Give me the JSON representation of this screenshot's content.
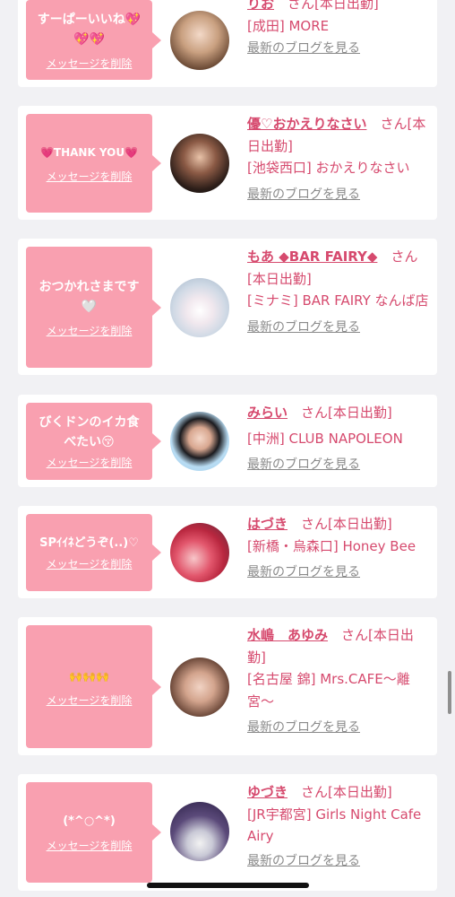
{
  "colors": {
    "bubble": "#f9a0b0",
    "accent": "#d64a6e",
    "link_gray": "#8a8a8a",
    "background": "#f1f1f4"
  },
  "common": {
    "delete_label": "メッセージを削除",
    "blog_label": "最新のブログを見る",
    "san": "さん"
  },
  "cards": [
    {
      "message": "すーぱーいいね💖💖💖",
      "name": "りお",
      "suffix": "さん[本日出勤]",
      "shop": "[成田] MORE",
      "avatar_icon": "avatar-photo"
    },
    {
      "message": "💗THANK YOU💗",
      "name": "優♡おかえりなさい",
      "suffix": "さん[本日出勤]",
      "shop": "[池袋西口] おかえりなさい",
      "avatar_icon": "avatar-photo"
    },
    {
      "message": "おつかれさまです🤍",
      "name": "もあ ◆BAR FAIRY◆",
      "suffix": "さん[本日出勤]",
      "shop": "[ミナミ] BAR FAIRY なんば店",
      "avatar_icon": "avatar-photo"
    },
    {
      "message": "びくドンのイカ食べたい😚",
      "name": "みらい",
      "suffix": "さん[本日出勤]",
      "shop": "[中洲] CLUB NAPOLEON",
      "avatar_icon": "avatar-photo"
    },
    {
      "message": "SPｲｲﾈどうぞ(..)♡",
      "name": "はづき",
      "suffix": "さん[本日出勤]",
      "shop": "[新橋・烏森口] Honey Bee",
      "avatar_icon": "avatar-photo"
    },
    {
      "message": "🙌🙌🙌",
      "name": "水嶋　あゆみ",
      "suffix": "さん[本日出勤]",
      "shop": "[名古屋 錦] Mrs.CAFE〜離宮〜",
      "avatar_icon": "avatar-photo"
    },
    {
      "message": "(*^○^*)",
      "name": "ゆづき",
      "suffix": "さん[本日出勤]",
      "shop": "[JR宇都宮] Girls Night Cafe Airy",
      "avatar_icon": "avatar-photo"
    }
  ]
}
